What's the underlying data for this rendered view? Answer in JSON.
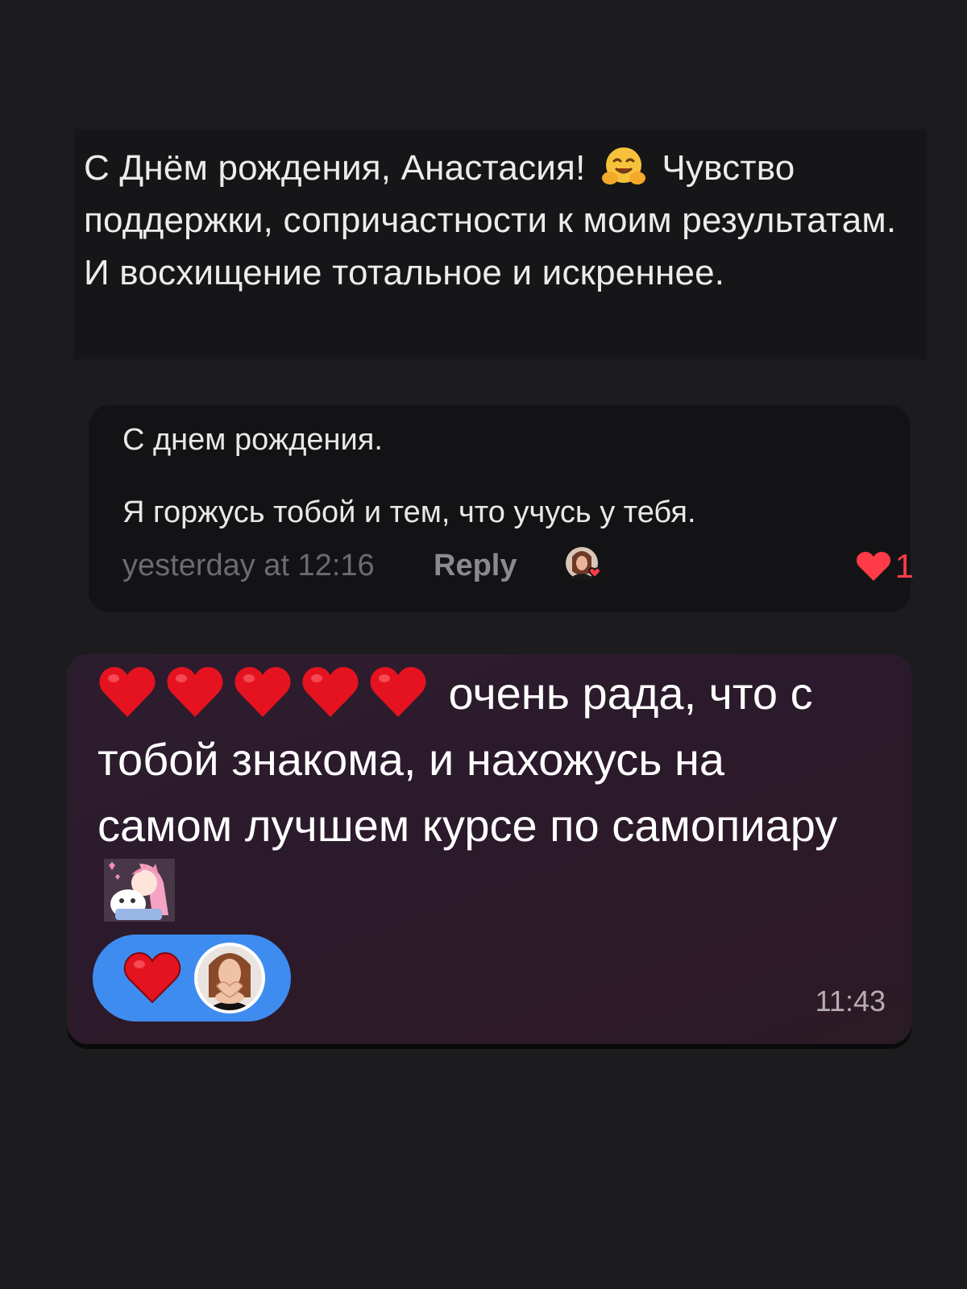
{
  "colors": {
    "background": "#1c1c1e",
    "text_primary": "#ececec",
    "text_muted": "#6b6b70",
    "reply": "#8a8a90",
    "like_red": "#ff3b47",
    "reaction_bubble": "#3f8cf0",
    "gradient_bubble": "#2c1d2e"
  },
  "message_1": {
    "part_before_emoji": "С Днём рождения, Анастасия!",
    "emoji_icon": "hugging-face-emoji",
    "part_after_emoji": "Чувство поддержки, сопричастности к моим результатам. И восхищение тотальное и искреннее."
  },
  "message_2": {
    "line_1": "С днем рождения.",
    "line_2": "Я горжусь тобой и тем, что учусь у тебя.",
    "timestamp": "yesterday at 12:16",
    "reply_label": "Reply",
    "liker_avatar_icon": "avatar-with-heart-icon",
    "like_icon": "heart-icon",
    "like_count": "1"
  },
  "message_3": {
    "heart_emojis": [
      "red-heart",
      "red-heart",
      "red-heart",
      "red-heart",
      "red-heart"
    ],
    "text": "очень рада, что с тобой знакома, и нахожусь на самом лучшем курсе по самопиару",
    "sticker_icon": "anime-girl-hug-sticker",
    "reaction_icon": "red-heart",
    "reaction_avatar_icon": "user-avatar",
    "time": "11:43"
  }
}
